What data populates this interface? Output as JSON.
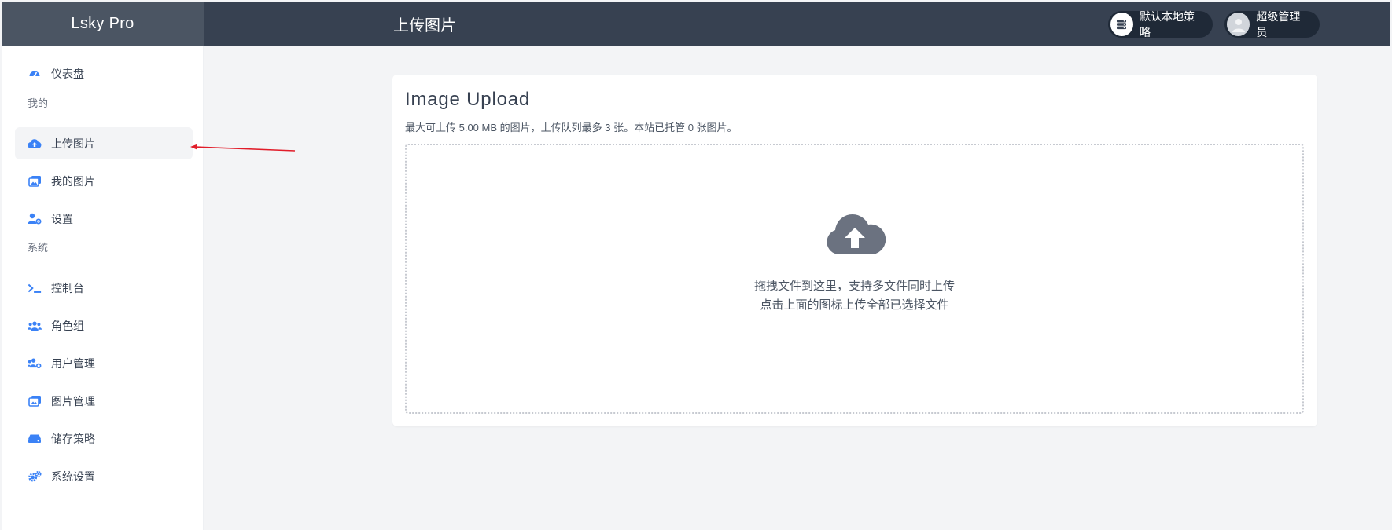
{
  "brand": "Lsky Pro",
  "header": {
    "title": "上传图片",
    "strategy_label": "默认本地策略",
    "user_label": "超级管理员"
  },
  "sidebar": {
    "dashboard": "仪表盘",
    "group_mine": "我的",
    "upload": "上传图片",
    "my_images": "我的图片",
    "settings": "设置",
    "group_system": "系统",
    "console": "控制台",
    "roles": "角色组",
    "users": "用户管理",
    "images_manage": "图片管理",
    "storage": "储存策略",
    "system_settings": "系统设置"
  },
  "upload_card": {
    "title": "Image Upload",
    "subtitle": "最大可上传 5.00 MB 的图片，上传队列最多 3 张。本站已托管 0 张图片。",
    "drop_line1": "拖拽文件到这里，支持多文件同时上传",
    "drop_line2": "点击上面的图标上传全部已选择文件"
  },
  "colors": {
    "topbar": "#374151",
    "brand_bg": "#4b5563",
    "icon_blue": "#3b82f6",
    "cloud_gray": "#6b7280",
    "arrow_red": "#e11d2a"
  }
}
